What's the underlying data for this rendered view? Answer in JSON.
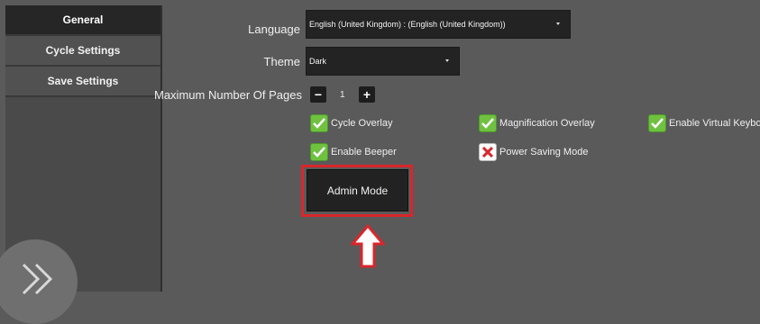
{
  "sidebar": {
    "items": [
      {
        "label": "General",
        "active": true
      },
      {
        "label": "Cycle Settings",
        "active": false
      },
      {
        "label": "Save Settings",
        "active": false
      }
    ],
    "expand_icon": "double-chevron-right-icon"
  },
  "settings": {
    "language": {
      "label": "Language",
      "value": "English (United Kingdom) :  (English (United Kingdom))"
    },
    "theme": {
      "label": "Theme",
      "value": "Dark"
    },
    "max_pages": {
      "label": "Maximum Number Of Pages",
      "value": "1",
      "minus": "−",
      "plus": "+"
    }
  },
  "options": [
    {
      "label": "Cycle Overlay",
      "checked": true
    },
    {
      "label": "Magnification Overlay",
      "checked": true
    },
    {
      "label": "Enable Virtual Keyboa",
      "checked": true
    },
    {
      "label": "Enable Beeper",
      "checked": true
    },
    {
      "label": "Power Saving Mode",
      "checked": false
    }
  ],
  "admin_button": {
    "label": "Admin Mode"
  },
  "colors": {
    "background": "#5a5a5a",
    "sidebar_active": "#262626",
    "checked": "#6fc140",
    "unchecked_mark": "#d9262c",
    "highlight": "#d9262c"
  }
}
